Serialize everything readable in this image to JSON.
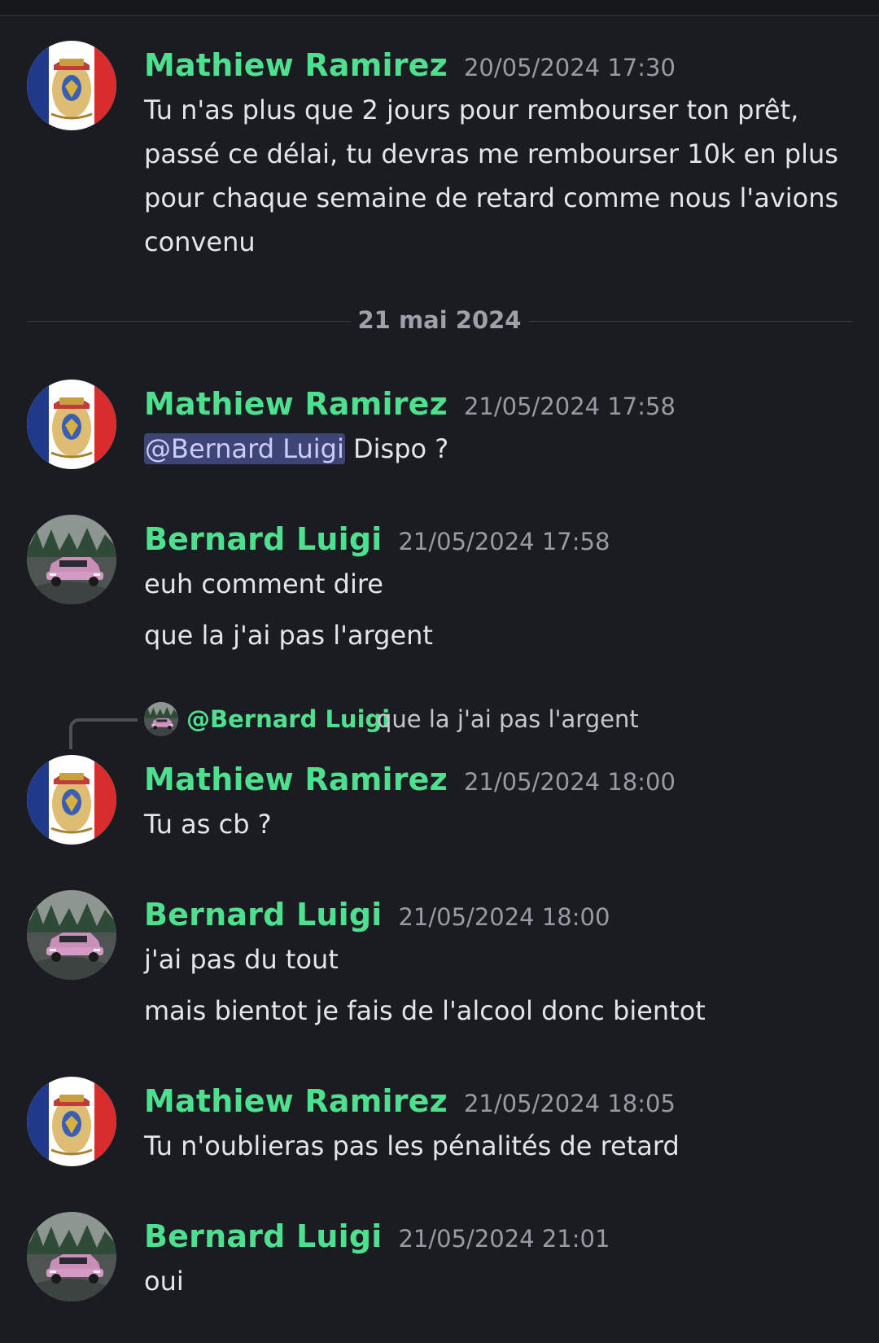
{
  "colors": {
    "background": "#1b1c22",
    "author_name": "#4ee08e",
    "timestamp": "#979ba3",
    "mention_bg": "#3e4473",
    "mention_text": "#c9cdfb"
  },
  "date_divider": "21 mai 2024",
  "messages": [
    {
      "author": "Mathiew Ramirez",
      "timestamp": "20/05/2024 17:30",
      "avatar_icon": "french-imperial-coat-of-arms-avatar",
      "lines": [
        "Tu n'as plus que 2 jours pour rembourser ton prêt, passé ce délai, tu devras me rembourser 10k en plus pour chaque semaine de retard comme nous l'avions convenu"
      ]
    },
    {
      "author": "Mathiew Ramirez",
      "timestamp": "21/05/2024 17:58",
      "avatar_icon": "french-imperial-coat-of-arms-avatar",
      "mention": "@Bernard Luigi",
      "text": " Dispo ?"
    },
    {
      "author": "Bernard Luigi",
      "timestamp": "21/05/2024 17:58",
      "avatar_icon": "pink-car-avatar",
      "lines": [
        "euh comment dire",
        "que la j'ai pas l'argent"
      ]
    },
    {
      "author": "Mathiew Ramirez",
      "timestamp": "21/05/2024 18:00",
      "avatar_icon": "french-imperial-coat-of-arms-avatar",
      "reply": {
        "author": "@Bernard Luigi",
        "text": "que la j'ai pas l'argent",
        "avatar_icon": "pink-car-avatar"
      },
      "lines": [
        "Tu as cb ?"
      ]
    },
    {
      "author": "Bernard Luigi",
      "timestamp": "21/05/2024 18:00",
      "avatar_icon": "pink-car-avatar",
      "lines": [
        "j'ai pas du tout",
        "mais bientot je fais de l'alcool donc bientot"
      ]
    },
    {
      "author": "Mathiew Ramirez",
      "timestamp": "21/05/2024 18:05",
      "avatar_icon": "french-imperial-coat-of-arms-avatar",
      "lines": [
        "Tu n'oublieras pas les pénalités de retard"
      ]
    },
    {
      "author": "Bernard Luigi",
      "timestamp": "21/05/2024 21:01",
      "avatar_icon": "pink-car-avatar",
      "lines": [
        "oui"
      ]
    }
  ]
}
